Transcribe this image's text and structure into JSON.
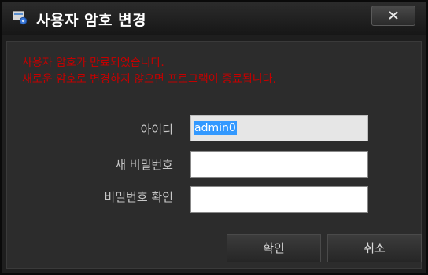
{
  "window": {
    "title": "사용자 암호 변경",
    "close_icon": "close-icon",
    "app_icon": "settings-gear-icon"
  },
  "message": {
    "line1": "사용자 암호가 만료되었습니다.",
    "line2": "새로운 암호로 변경하지 않으면 프로그램이 종료됩니다.",
    "color": "#c40000"
  },
  "form": {
    "id_label": "아이디",
    "id_value": "admin0",
    "new_password_label": "새 비밀번호",
    "new_password_value": "",
    "confirm_password_label": "비밀번호 확인",
    "confirm_password_value": ""
  },
  "buttons": {
    "ok_label": "확인",
    "cancel_label": "취소"
  }
}
